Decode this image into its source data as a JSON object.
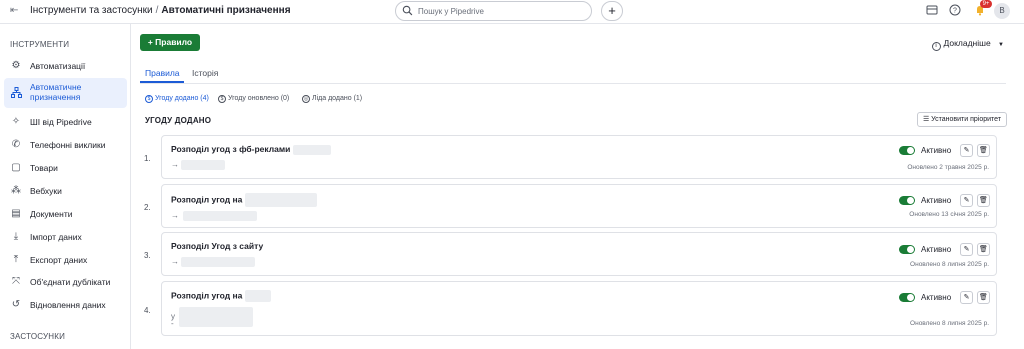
{
  "header": {
    "breadcrumb_parent": "Інструменти та застосунки",
    "breadcrumb_sep": "/",
    "breadcrumb_current": "Автоматичні призначення",
    "search_placeholder": "Пошук у Pipedrive",
    "add_label": "+",
    "notification_badge": "9+",
    "avatar_initial": "В"
  },
  "sidebar": {
    "tools_heading": "ІНСТРУМЕНТИ",
    "apps_heading": "ЗАСТОСУНКИ",
    "items": [
      {
        "label": "Автоматизації",
        "icon": "robot-icon"
      },
      {
        "label": "Автоматичне призначення",
        "icon": "hierarchy-icon",
        "active": true
      },
      {
        "label": "ШІ від Pipedrive",
        "icon": "sparkle-icon"
      },
      {
        "label": "Телефонні виклики",
        "icon": "phone-icon"
      },
      {
        "label": "Товари",
        "icon": "box-icon"
      },
      {
        "label": "Вебхуки",
        "icon": "webhook-icon"
      },
      {
        "label": "Документи",
        "icon": "document-icon"
      },
      {
        "label": "Імпорт даних",
        "icon": "import-icon"
      },
      {
        "label": "Експорт даних",
        "icon": "export-icon"
      },
      {
        "label": "Об'єднати дублікати",
        "icon": "merge-icon"
      },
      {
        "label": "Відновлення даних",
        "icon": "restore-icon"
      }
    ]
  },
  "main": {
    "rule_button": "+ Правило",
    "details_link": "Докладніше",
    "tabs": [
      {
        "label": "Правила",
        "active": true
      },
      {
        "label": "Історія",
        "active": false
      }
    ],
    "filters": [
      {
        "label": "Угоду додано (4)",
        "active": true
      },
      {
        "label": "Угоду оновлено (0)",
        "active": false
      },
      {
        "label": "Ліда додано (1)",
        "active": false
      }
    ],
    "section_title": "УГОДУ ДОДАНО",
    "priority_button": "Установити пріоритет",
    "rules": [
      {
        "number": "1.",
        "title": "Розподіл угод з фб-реклами",
        "subtitle": "→",
        "status": "Активно",
        "updated": "Оновлено 2 травня 2025 р."
      },
      {
        "number": "2.",
        "title": "Розподіл угод на",
        "subtitle": "→",
        "status": "Активно",
        "updated": "Оновлено 13 січня 2025 р."
      },
      {
        "number": "3.",
        "title": "Розподіл Угод з сайту",
        "subtitle": "→",
        "status": "Активно",
        "updated": "Оновлено 8 липня 2025 р."
      },
      {
        "number": "4.",
        "title": "Розподіл угод на",
        "subtitle": "у",
        "subtitle2": "-",
        "status": "Активно",
        "updated": "Оновлено 8 липня 2025 р."
      }
    ]
  },
  "colors": {
    "accent": "#1c5bd6",
    "primary_button": "#1a7c36",
    "toggle_on": "#1a7c36",
    "notification": "#d9322f"
  }
}
